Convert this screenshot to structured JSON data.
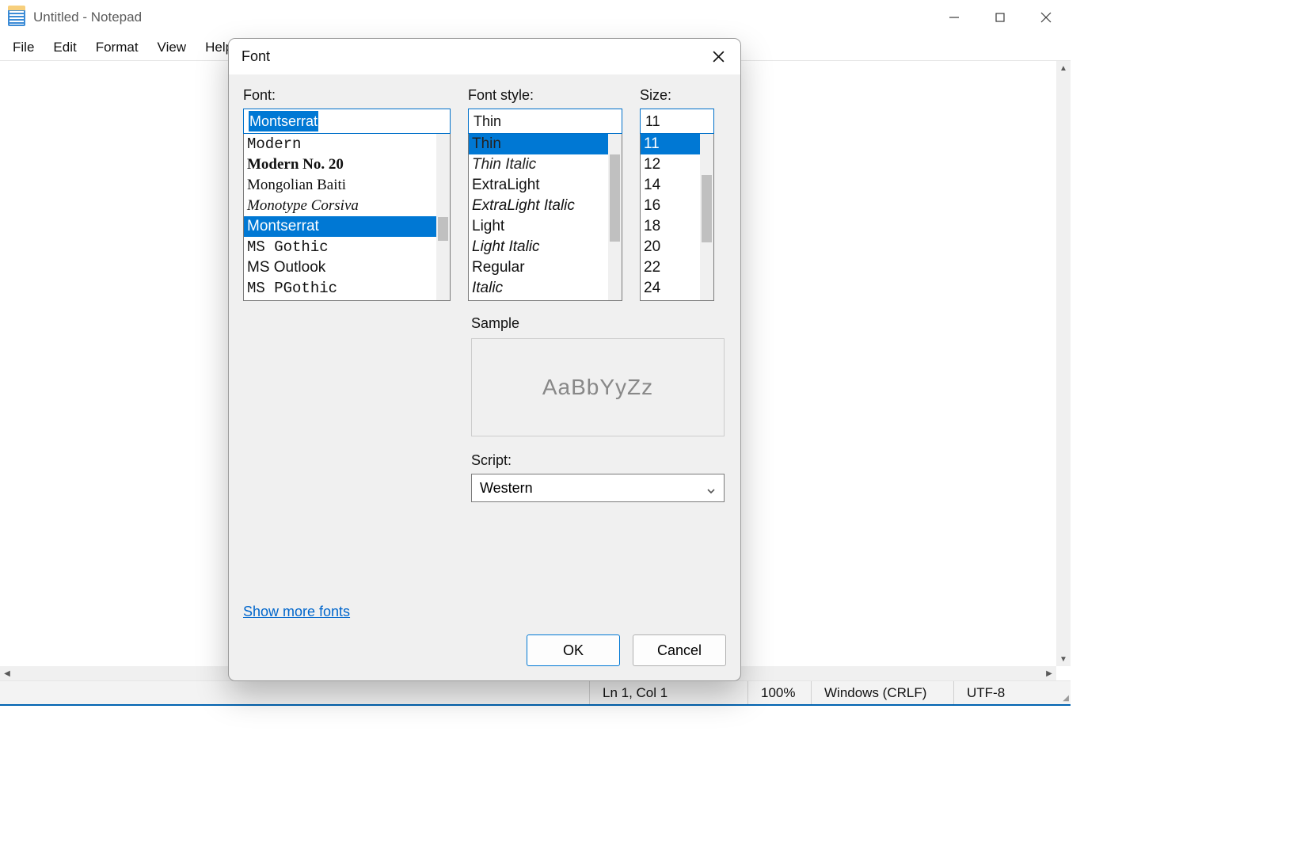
{
  "window": {
    "title": "Untitled - Notepad"
  },
  "menu": {
    "file": "File",
    "edit": "Edit",
    "format": "Format",
    "view": "View",
    "help": "Help"
  },
  "statusbar": {
    "position": "Ln 1, Col 1",
    "zoom": "100%",
    "line_ending": "Windows (CRLF)",
    "encoding": "UTF-8"
  },
  "dialog": {
    "title": "Font",
    "font_label": "Font:",
    "style_label": "Font style:",
    "size_label": "Size:",
    "font_value": "Montserrat",
    "style_value": "Thin",
    "size_value": "11",
    "fonts": [
      "Modern",
      "Modern No. 20",
      "Mongolian Baiti",
      "Monotype Corsiva",
      "Montserrat",
      "MS Gothic",
      "MS Outlook",
      "MS PGothic"
    ],
    "styles": [
      "Thin",
      "Thin Italic",
      "ExtraLight",
      "ExtraLight Italic",
      "Light",
      "Light Italic",
      "Regular",
      "Italic"
    ],
    "sizes": [
      "11",
      "12",
      "14",
      "16",
      "18",
      "20",
      "22",
      "24"
    ],
    "sample_label": "Sample",
    "sample_text": "AaBbYyZz",
    "script_label": "Script:",
    "script_value": "Western",
    "more_fonts": "Show more fonts",
    "ok": "OK",
    "cancel": "Cancel"
  }
}
